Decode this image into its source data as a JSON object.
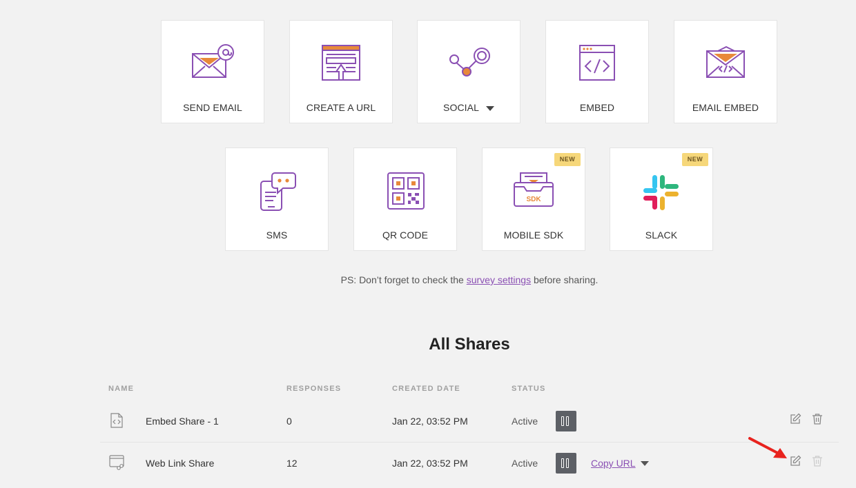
{
  "share_options": [
    {
      "label": "SEND EMAIL",
      "icon": "send-email-icon"
    },
    {
      "label": "CREATE A URL",
      "icon": "create-url-icon"
    },
    {
      "label": "SOCIAL",
      "icon": "social-icon"
    },
    {
      "label": "EMBED",
      "icon": "embed-icon"
    },
    {
      "label": "EMAIL EMBED",
      "icon": "email-embed-icon"
    },
    {
      "label": "SMS",
      "icon": "sms-icon"
    },
    {
      "label": "QR CODE",
      "icon": "qr-code-icon"
    },
    {
      "label": "MOBILE SDK",
      "icon": "mobile-sdk-icon",
      "badge": "NEW",
      "icon_text": "SDK"
    },
    {
      "label": "SLACK",
      "icon": "slack-icon",
      "badge": "NEW"
    }
  ],
  "ps_note": {
    "prefix": "PS: Don’t forget to check the ",
    "link": "survey settings",
    "suffix": " before sharing."
  },
  "all_shares": {
    "title": "All Shares",
    "columns": [
      "NAME",
      "RESPONSES",
      "CREATED DATE",
      "STATUS"
    ],
    "rows": [
      {
        "name": "Embed Share - 1",
        "responses": "0",
        "created": "Jan 22, 03:52 PM",
        "status": "Active",
        "icon": "embed-file-icon"
      },
      {
        "name": "Web Link Share",
        "responses": "12",
        "created": "Jan 22, 03:52 PM",
        "status": "Active",
        "icon": "web-link-icon",
        "copy_label": "Copy URL"
      }
    ]
  },
  "colors": {
    "accent": "#8a4fb3",
    "icon_orange": "#e8893a",
    "badge": "#f6d77a",
    "pause_button": "#5d6066",
    "annotation_arrow": "#e8231e"
  }
}
